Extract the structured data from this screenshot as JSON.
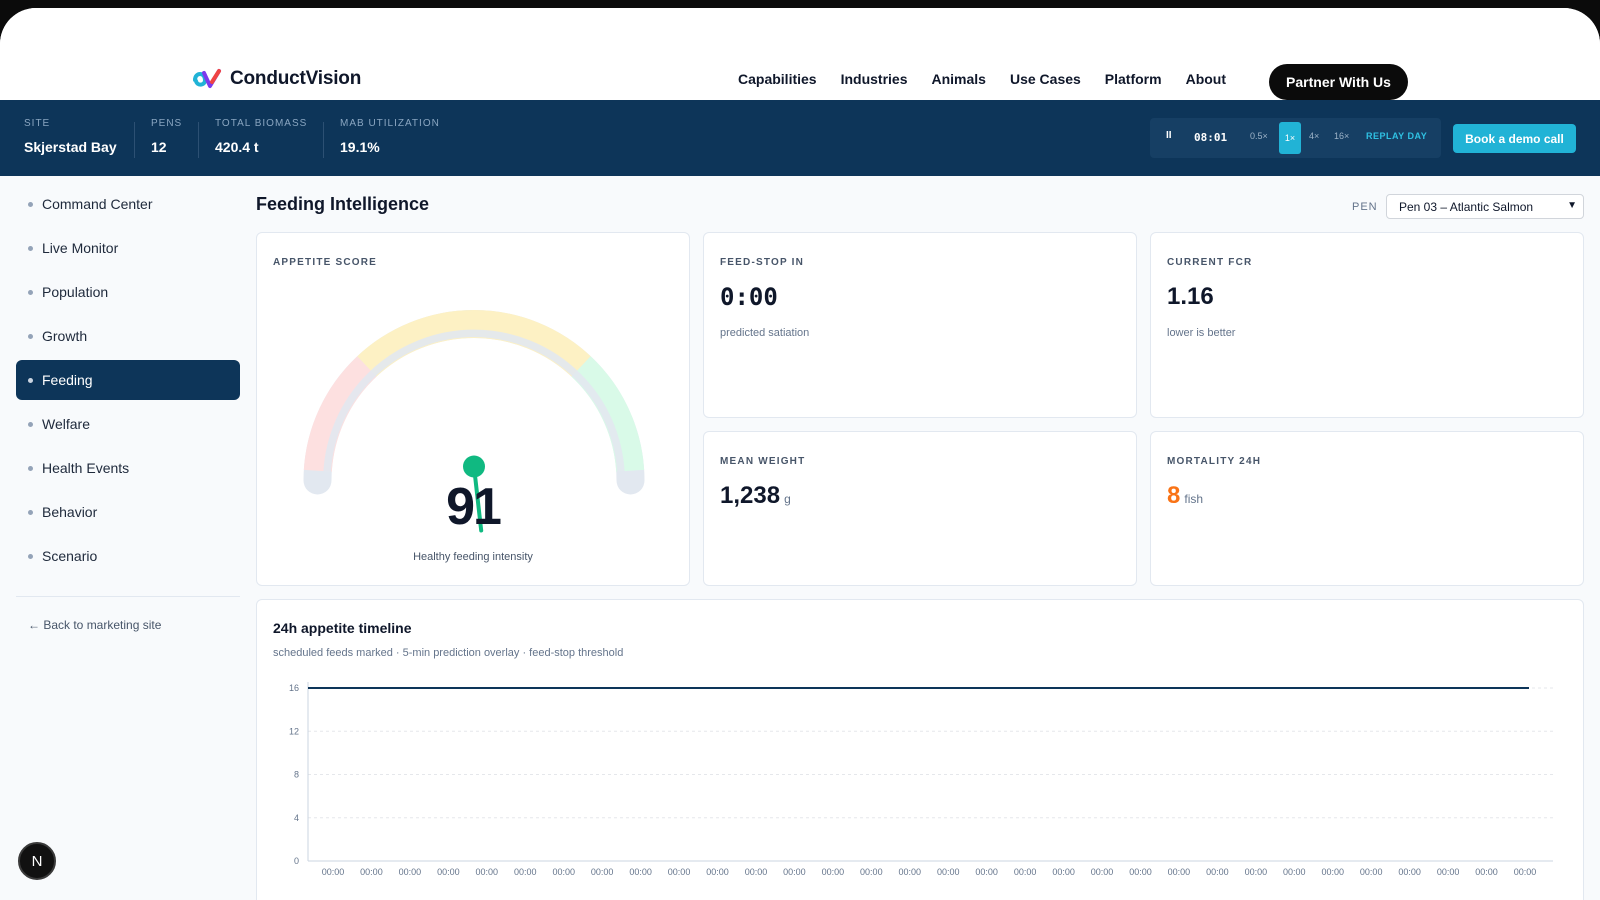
{
  "brand": {
    "name": "ConductVision"
  },
  "nav": {
    "links": [
      "Capabilities",
      "Industries",
      "Animals",
      "Use Cases",
      "Platform",
      "About"
    ],
    "cta": "Partner With Us"
  },
  "site_bar": {
    "stats": [
      {
        "label": "SITE",
        "value": "Skjerstad Bay"
      },
      {
        "label": "PENS",
        "value": "12"
      },
      {
        "label": "TOTAL BIOMASS",
        "value": "420.4 t"
      },
      {
        "label": "MAB UTILIZATION",
        "value": "19.1%"
      }
    ],
    "player": {
      "pause_icon": "pause-icon",
      "pause_glyph": "II",
      "time": "08:01",
      "speeds": [
        "0.5×",
        "1×",
        "4×",
        "16×"
      ],
      "active_speed": "1×",
      "replay_label": "REPLAY DAY"
    },
    "demo_button": "Book a demo call"
  },
  "sidebar": {
    "items": [
      {
        "label": "Command Center",
        "active": false
      },
      {
        "label": "Live Monitor",
        "active": false
      },
      {
        "label": "Population",
        "active": false
      },
      {
        "label": "Growth",
        "active": false
      },
      {
        "label": "Feeding",
        "active": true
      },
      {
        "label": "Welfare",
        "active": false
      },
      {
        "label": "Health Events",
        "active": false
      },
      {
        "label": "Behavior",
        "active": false
      },
      {
        "label": "Scenario",
        "active": false
      }
    ],
    "back_link": "← Back to marketing site"
  },
  "n_badge": "N",
  "main": {
    "title": "Feeding Intelligence",
    "pen_label": "PEN",
    "pen_selected": "Pen 03 – Atlantic Salmon",
    "appetite": {
      "label": "APPETITE SCORE",
      "score": "91",
      "score_value": 91,
      "caption": "Healthy feeding intensity"
    },
    "feed_stop": {
      "label": "FEED-STOP IN",
      "value": "0:00",
      "sub": "predicted satiation"
    },
    "fcr": {
      "label": "CURRENT FCR",
      "value": "1.16",
      "sub": "lower is better"
    },
    "mean_weight": {
      "label": "MEAN WEIGHT",
      "value": "1,238",
      "unit": "g"
    },
    "mortality": {
      "label": "MORTALITY 24H",
      "value": "8",
      "unit": "fish"
    },
    "timeline": {
      "title": "24h appetite timeline",
      "subtitle": "scheduled feeds marked · 5-min prediction overlay · feed-stop threshold"
    }
  },
  "colors": {
    "navy": "#0d3559",
    "accent": "#21b3d6",
    "gauge_red": "#fde0e0",
    "gauge_yellow": "#fdf1c4",
    "gauge_green": "#d9fae8",
    "needle": "#10b981",
    "mortality": "#f97316"
  },
  "chart_data": {
    "type": "line",
    "title": "24h appetite timeline",
    "ylim": [
      0,
      16
    ],
    "yticks": [
      0,
      4,
      8,
      12,
      16
    ],
    "x": [
      "00:00",
      "00:00",
      "00:00",
      "00:00",
      "00:00",
      "00:00",
      "00:00",
      "00:00",
      "00:00",
      "00:00",
      "00:00",
      "00:00",
      "00:00",
      "00:00",
      "00:00",
      "00:00",
      "00:00",
      "00:00",
      "00:00",
      "00:00",
      "00:00",
      "00:00",
      "00:00",
      "00:00",
      "00:00",
      "00:00",
      "00:00",
      "00:00",
      "00:00",
      "00:00",
      "00:00",
      "00:00"
    ],
    "series": [
      {
        "values": [
          16,
          16,
          16,
          16,
          16,
          16,
          16,
          16,
          16,
          16,
          16,
          16,
          16,
          16,
          16,
          16,
          16,
          16,
          16,
          16,
          16,
          16,
          16,
          16,
          16,
          16,
          16,
          16,
          16,
          16,
          16,
          16
        ]
      }
    ],
    "grid": true
  }
}
